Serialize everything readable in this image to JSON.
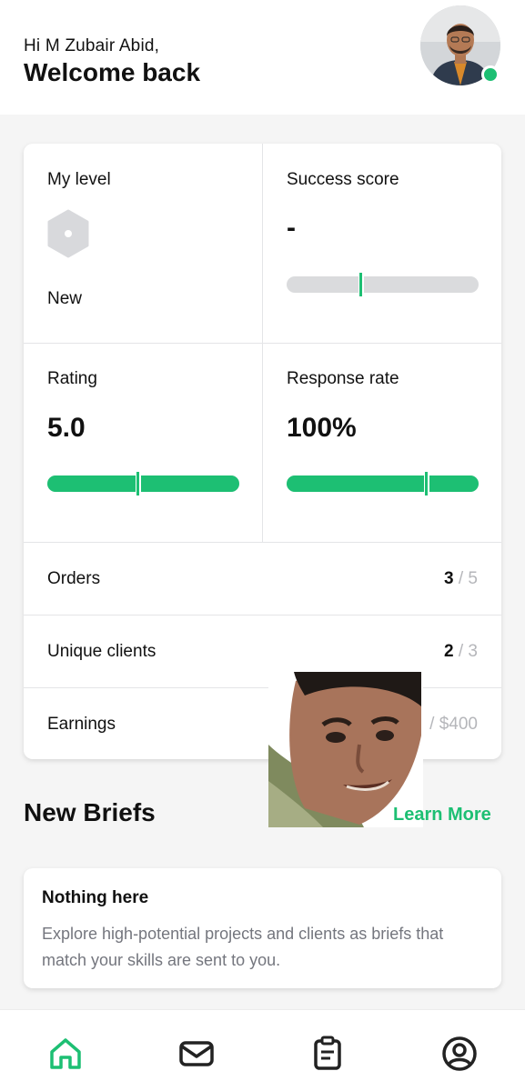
{
  "header": {
    "greeting": "Hi M Zubair Abid,",
    "welcome": "Welcome back",
    "avatar_icon": "user-avatar-photo",
    "status": "online",
    "status_color": "#1dbf73"
  },
  "stats": {
    "level": {
      "title": "My level",
      "value": "New",
      "icon": "hexagon-badge-icon"
    },
    "success_score": {
      "title": "Success score",
      "value": "-",
      "bar_level": 0.39
    },
    "rating": {
      "title": "Rating",
      "value": "5.0",
      "bar_level": 1.0
    },
    "response_rate": {
      "title": "Response rate",
      "value": "100%",
      "bar_level": 1.0
    },
    "rows": [
      {
        "label": "Orders",
        "current": "3",
        "separator": "/",
        "target": "5"
      },
      {
        "label": "Unique clients",
        "current": "2",
        "separator": "/",
        "target": "3"
      },
      {
        "label": "Earnings",
        "current": "",
        "separator": "/",
        "target": "$400"
      }
    ]
  },
  "briefs": {
    "title": "New Briefs",
    "learn_more": "Learn More",
    "empty_heading": "Nothing here",
    "empty_text": "Explore high-potential projects and clients as briefs that match your skills are sent to you."
  },
  "nav": {
    "items": [
      {
        "name": "home",
        "icon": "home-icon",
        "active": true
      },
      {
        "name": "messages",
        "icon": "envelope-icon",
        "active": false
      },
      {
        "name": "orders",
        "icon": "clipboard-icon",
        "active": false
      },
      {
        "name": "profile",
        "icon": "user-circle-icon",
        "active": false
      }
    ]
  },
  "colors": {
    "accent": "#1dbf73",
    "bar_track": "#dadbdd",
    "text_muted": "#74767e"
  }
}
